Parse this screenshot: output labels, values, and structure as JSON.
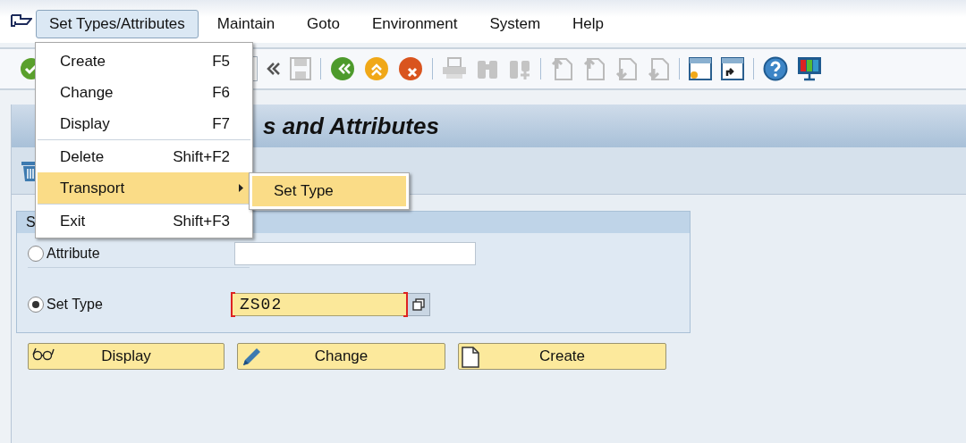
{
  "menu_bar": {
    "items": [
      {
        "label": "Set Types/Attributes",
        "selected": true
      },
      {
        "label": "Maintain",
        "selected": false
      },
      {
        "label": "Goto",
        "selected": false
      },
      {
        "label": "Environment",
        "selected": false
      },
      {
        "label": "System",
        "selected": false
      },
      {
        "label": "Help",
        "selected": false
      }
    ]
  },
  "dropdown_menu": {
    "items": [
      {
        "label": "Create",
        "shortcut": "F5",
        "selected": false,
        "separator_before": false,
        "has_submenu": false
      },
      {
        "label": "Change",
        "shortcut": "F6",
        "selected": false,
        "separator_before": false,
        "has_submenu": false
      },
      {
        "label": "Display",
        "shortcut": "F7",
        "selected": false,
        "separator_before": false,
        "has_submenu": false
      },
      {
        "label": "Delete",
        "shortcut": "Shift+F2",
        "selected": false,
        "separator_before": true,
        "has_submenu": false
      },
      {
        "label": "Transport",
        "selected": true,
        "separator_before": false,
        "has_submenu": true
      },
      {
        "label": "Exit",
        "shortcut": "Shift+F3",
        "selected": false,
        "separator_before": true,
        "has_submenu": false
      }
    ],
    "submenu": {
      "items": [
        {
          "label": "Set Type",
          "selected": true
        }
      ]
    }
  },
  "title": "s and Attributes",
  "group_box": {
    "title": "S",
    "options": [
      {
        "label": "Attribute",
        "selected": false,
        "focused": false
      },
      {
        "label": "Set Type",
        "selected": true,
        "focused": true,
        "value": "ZS02"
      }
    ]
  },
  "buttons": [
    {
      "label": "Display",
      "kind": "glasses"
    },
    {
      "label": "Change",
      "kind": "pencil"
    },
    {
      "label": "Create",
      "kind": "page"
    }
  ]
}
